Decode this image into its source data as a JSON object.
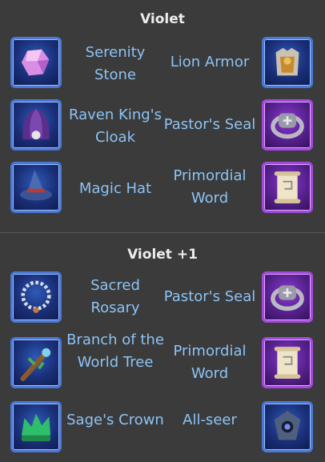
{
  "sections": [
    {
      "title": "Violet",
      "rows": [
        {
          "left_item": "Serenity Stone",
          "left_icon": "gem-icon",
          "right_item": "Lion Armor",
          "right_icon": "armor-icon"
        },
        {
          "left_item": "Raven King's Cloak",
          "left_icon": "cloak-icon",
          "right_item": "Pastor's Seal",
          "right_icon": "ring-icon"
        },
        {
          "left_item": "Magic Hat",
          "left_icon": "hat-icon",
          "right_item": "Primordial Word",
          "right_icon": "scroll-icon"
        }
      ]
    },
    {
      "title": "Violet +1",
      "rows": [
        {
          "left_item": "Sacred Rosary",
          "left_icon": "rosary-icon",
          "right_item": "Pastor's Seal",
          "right_icon": "ring-icon"
        },
        {
          "left_item": "Branch of the World Tree",
          "left_icon": "branch-icon",
          "right_item": "Primordial Word",
          "right_icon": "scroll-icon"
        },
        {
          "left_item": "Sage's Crown",
          "left_icon": "crown-icon",
          "right_item": "All-seer",
          "right_icon": "amulet-icon"
        }
      ]
    }
  ],
  "colors": {
    "background": "#3b3b3b",
    "title": "#ececec",
    "item_text": "#8cc3f5",
    "blue_frame": "#4a78d6",
    "purple_frame": "#a548e0"
  }
}
